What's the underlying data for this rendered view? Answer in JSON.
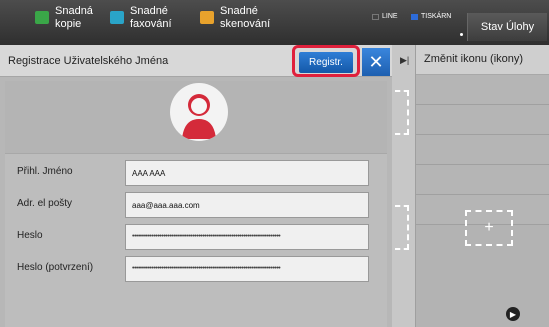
{
  "topbar": {
    "quick_copy": "Snadná\nkopie",
    "quick_fax": "Snadné\nfaxování",
    "quick_scan": "Snadné\nskenování",
    "line_status": "LINE",
    "printer_status": "TISKÁRN",
    "job_status_label": "Stav Úlohy"
  },
  "background_screen": {
    "title": "Změnit ikonu (ikony)",
    "plus": "+"
  },
  "dialog": {
    "title": "Registrace Uživatelského Jména",
    "register_label": "Registr.",
    "close_symbol": "✕",
    "fields": [
      {
        "label": "Přihl. Jméno",
        "value": "AAA AAA"
      },
      {
        "label": "Adr. el pošty",
        "value": "aaa@aaa.aaa.com"
      },
      {
        "label": "Heslo",
        "value": "••••••••••••••••••••••••••••••••••••••••••••••••••••••••••••••••••••••••••••"
      },
      {
        "label": "Heslo (potvrzení)",
        "value": "••••••••••••••••••••••••••••••••••••••••••••••••••••••••••••••••••••••••••••"
      }
    ]
  },
  "colors": {
    "accent_blue": "#1a66c0",
    "highlight_red": "#e0203c",
    "avatar_red": "#d42a3a"
  }
}
